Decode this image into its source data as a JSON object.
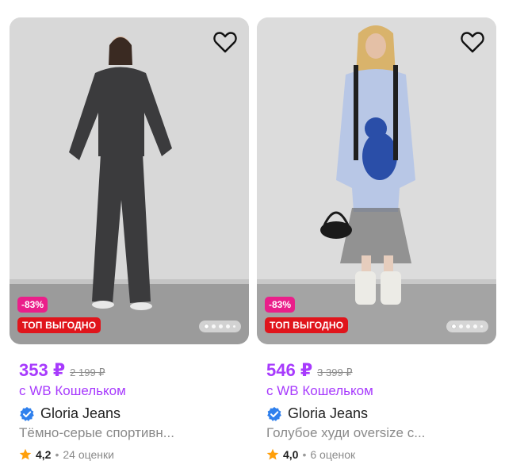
{
  "products": [
    {
      "discount": "-83%",
      "top_badge": "ТОП ВЫГОДНО",
      "price": "353 ₽",
      "old_price": "2 199 ₽",
      "wallet_label": "с WB Кошельком",
      "brand": "Gloria Jeans",
      "name": "Тёмно-серые спортивн...",
      "rating": "4,2",
      "reviews": "24 оценки",
      "photo_colors": {
        "bg": "#d9d9d9",
        "floor": "#9a9a9a",
        "outfit": "#3a3a3c"
      }
    },
    {
      "discount": "-83%",
      "top_badge": "ТОП ВЫГОДНО",
      "price": "546 ₽",
      "old_price": "3 399 ₽",
      "wallet_label": "с WB Кошельком",
      "brand": "Gloria Jeans",
      "name": "Голубое худи oversize с...",
      "rating": "4,0",
      "reviews": "6 оценок",
      "photo_colors": {
        "bg": "#dddddd",
        "floor": "#a3a3a3",
        "outfit": "#b7c6e6"
      }
    }
  ],
  "colors": {
    "price": "#a73afd",
    "discount": "#ea1f8a",
    "top_badge": "#e0151c",
    "star": "#ff9f0a",
    "verified": "#2f80ed"
  },
  "icons": [
    "heart-icon",
    "verified-icon",
    "star-icon"
  ]
}
